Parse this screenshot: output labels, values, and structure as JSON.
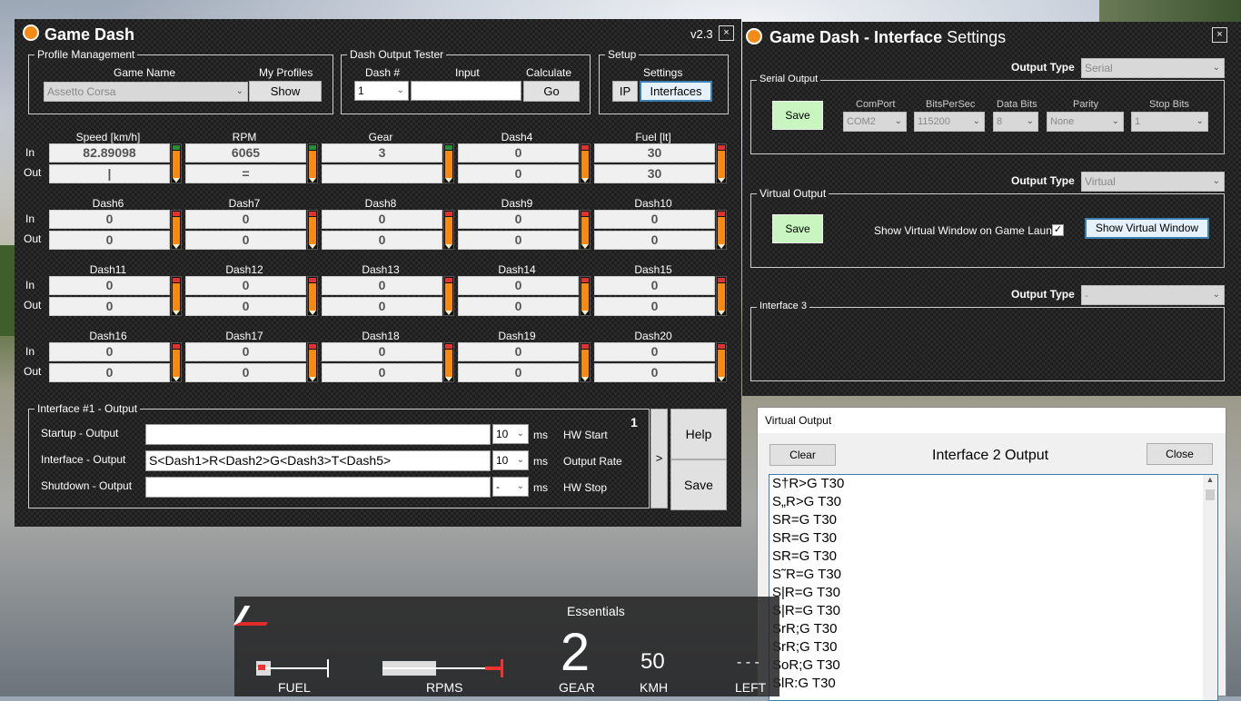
{
  "main": {
    "title_bold": "Game Dash",
    "version": "v2.3",
    "close": "×",
    "profile": {
      "legend": "Profile Management",
      "game_name_label": "Game Name",
      "game_name": "Assetto Corsa",
      "my_profiles_label": "My Profiles",
      "show_btn": "Show"
    },
    "tester": {
      "legend": "Dash Output Tester",
      "dash_label": "Dash #",
      "dash_value": "1",
      "input_label": "Input",
      "calc_label": "Calculate",
      "go_btn": "Go"
    },
    "setup": {
      "legend": "Setup",
      "settings_label": "Settings",
      "ip_btn": "IP",
      "interfaces_btn": "Interfaces"
    },
    "in_label": "In",
    "out_label": "Out",
    "dashes": [
      {
        "label": "Speed [km/h]",
        "in": "82.89098",
        "out": "|",
        "cap": "green"
      },
      {
        "label": "RPM",
        "in": "6065",
        "out": "=",
        "cap": "green"
      },
      {
        "label": "Gear",
        "in": "3",
        "out": "",
        "cap": "green"
      },
      {
        "label": "Dash4",
        "in": "0",
        "out": "0",
        "cap": "red"
      },
      {
        "label": "Fuel [lt]",
        "in": "30",
        "out": "30",
        "cap": "red"
      },
      {
        "label": "Dash6",
        "in": "0",
        "out": "0",
        "cap": "red"
      },
      {
        "label": "Dash7",
        "in": "0",
        "out": "0",
        "cap": "red"
      },
      {
        "label": "Dash8",
        "in": "0",
        "out": "0",
        "cap": "red"
      },
      {
        "label": "Dash9",
        "in": "0",
        "out": "0",
        "cap": "red"
      },
      {
        "label": "Dash10",
        "in": "0",
        "out": "0",
        "cap": "red"
      },
      {
        "label": "Dash11",
        "in": "0",
        "out": "0",
        "cap": "red"
      },
      {
        "label": "Dash12",
        "in": "0",
        "out": "0",
        "cap": "red"
      },
      {
        "label": "Dash13",
        "in": "0",
        "out": "0",
        "cap": "red"
      },
      {
        "label": "Dash14",
        "in": "0",
        "out": "0",
        "cap": "red"
      },
      {
        "label": "Dash15",
        "in": "0",
        "out": "0",
        "cap": "red"
      },
      {
        "label": "Dash16",
        "in": "0",
        "out": "0",
        "cap": "red"
      },
      {
        "label": "Dash17",
        "in": "0",
        "out": "0",
        "cap": "red"
      },
      {
        "label": "Dash18",
        "in": "0",
        "out": "0",
        "cap": "red"
      },
      {
        "label": "Dash19",
        "in": "0",
        "out": "0",
        "cap": "red"
      },
      {
        "label": "Dash20",
        "in": "0",
        "out": "0",
        "cap": "red"
      }
    ],
    "iface": {
      "legend": "Interface #1 - Output",
      "number": "1",
      "startup_label": "Startup - Output",
      "startup_value": "",
      "startup_ms": "10",
      "interface_label": "Interface - Output",
      "interface_value": "S<Dash1>R<Dash2>G<Dash3>T<Dash5>",
      "interface_ms": "10",
      "shutdown_label": "Shutdown - Output",
      "shutdown_value": "",
      "shutdown_ms": "-",
      "ms": "ms",
      "hw_start": "HW Start",
      "output_rate": "Output Rate",
      "hw_stop": "HW Stop",
      "arrow_btn": ">",
      "help_btn": "Help",
      "save_btn": "Save"
    }
  },
  "settings": {
    "title_a": "Game Dash - ",
    "title_b": "Interface",
    "title_c": " Settings",
    "close": "×",
    "output_type_label": "Output Type",
    "serial": {
      "type": "Serial",
      "legend": "Serial Output",
      "save": "Save",
      "comport_label": "ComPort",
      "comport": "COM2",
      "bps_label": "BitsPerSec",
      "bps": "115200",
      "databits_label": "Data Bits",
      "databits": "8",
      "parity_label": "Parity",
      "parity": "None",
      "stopbits_label": "Stop Bits",
      "stopbits": "1"
    },
    "virtual": {
      "type": "Virtual",
      "legend": "Virtual Output",
      "save": "Save",
      "show_on_launch": "Show Virtual Window on Game Launch",
      "show_btn": "Show Virtual Window"
    },
    "iface3": {
      "type": "-",
      "legend": "Interface 3"
    }
  },
  "virtual_window": {
    "title": "Virtual Output",
    "clear_btn": "Clear",
    "heading": "Interface 2 Output",
    "close_btn": "Close",
    "lines": [
      "S†R>G T30",
      "S„R>G T30",
      "SR=G T30",
      "SR=G T30",
      "SR=G T30",
      "S˜R=G T30",
      "S|R=G T30",
      "S|R=G T30",
      "SrR;G T30",
      "SrR;G T30",
      "SoR;G T30",
      "SlR:G T30"
    ]
  },
  "hud": {
    "title": "Essentials",
    "gear_value": "2",
    "gear_label": "GEAR",
    "speed_value": "50",
    "speed_label": "KMH",
    "fuel_label": "FUEL",
    "rpm_label": "RPMS",
    "left_label": "LEFT",
    "left_value": "- - -",
    "fuel_level": 0.2,
    "rpm_level": 0.45
  },
  "colors": {
    "accent": "#3c7fb1",
    "green_save": "#c8f5c0",
    "pencil": "#f58b14"
  }
}
